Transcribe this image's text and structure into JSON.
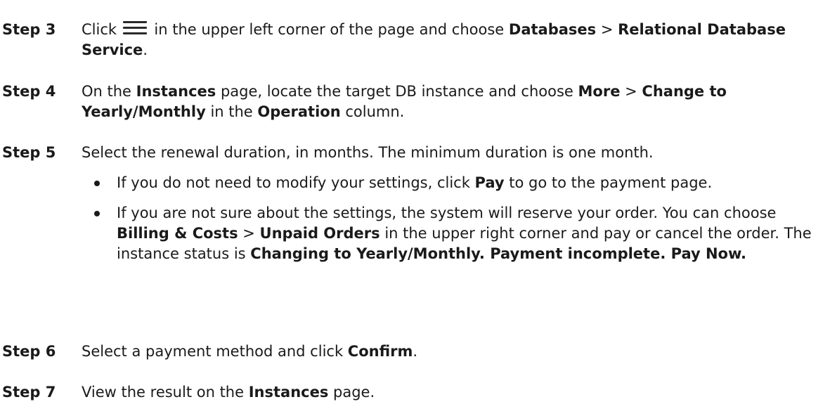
{
  "steps": [
    {
      "label": "Step 3",
      "parts": [
        {
          "t": "Click "
        },
        {
          "icon": "menu-icon"
        },
        {
          "t": " in the upper left corner of the page and choose "
        },
        {
          "b": "Databases"
        },
        {
          "t": " > "
        },
        {
          "b": "Relational Database Service"
        },
        {
          "t": "."
        }
      ]
    },
    {
      "label": "Step 4",
      "parts": [
        {
          "t": "On the "
        },
        {
          "b": "Instances"
        },
        {
          "t": " page, locate the target DB instance and choose "
        },
        {
          "b": "More"
        },
        {
          "t": " > "
        },
        {
          "b": "Change to Yearly/Monthly"
        },
        {
          "t": " in the "
        },
        {
          "b": "Operation"
        },
        {
          "t": " column."
        }
      ]
    },
    {
      "label": "Step 5",
      "parts": [
        {
          "t": "Select the renewal duration, in months. The minimum duration is one month."
        }
      ],
      "bullets": [
        [
          {
            "t": "If you do not need to modify your settings, click "
          },
          {
            "b": "Pay"
          },
          {
            "t": " to go to the payment page."
          }
        ],
        [
          {
            "t": "If you are not sure about the settings, the system will reserve your order. You can choose "
          },
          {
            "b": "Billing & Costs"
          },
          {
            "t": " > "
          },
          {
            "b": "Unpaid Orders"
          },
          {
            "t": " in the upper right corner and pay or cancel the order. The instance status is "
          },
          {
            "b": "Changing to Yearly/Monthly. Payment incomplete. Pay Now."
          }
        ]
      ]
    },
    {
      "label": "Step 6",
      "parts": [
        {
          "t": "Select a payment method and click "
        },
        {
          "b": "Confirm"
        },
        {
          "t": "."
        }
      ]
    },
    {
      "label": "Step 7",
      "parts": [
        {
          "t": "View the result on the "
        },
        {
          "b": "Instances"
        },
        {
          "t": " page."
        }
      ]
    }
  ]
}
